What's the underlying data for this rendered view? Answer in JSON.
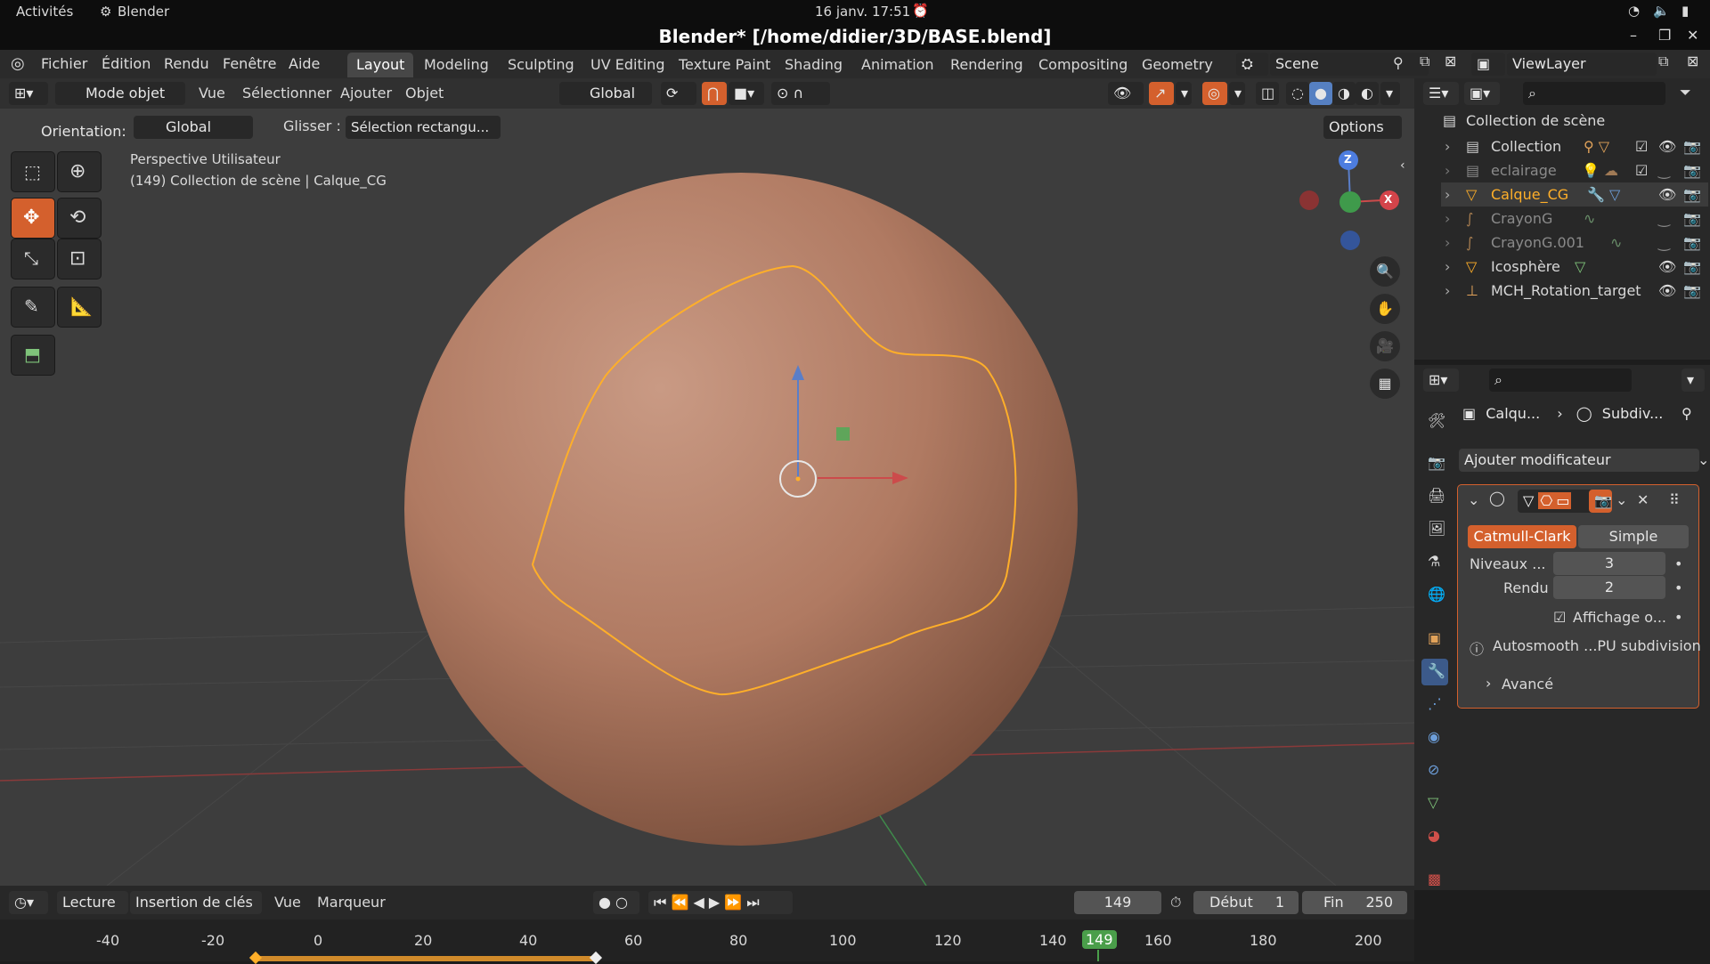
{
  "gnome": {
    "activities": "Activités",
    "app": "Blender",
    "clock": "16 janv.  17:51"
  },
  "window": {
    "title": "Blender* [/home/didier/3D/BASE.blend]"
  },
  "menus": [
    "Fichier",
    "Édition",
    "Rendu",
    "Fenêtre",
    "Aide"
  ],
  "workspaces": [
    "Layout",
    "Modeling",
    "Sculpting",
    "UV Editing",
    "Texture Paint",
    "Shading",
    "Animation",
    "Rendering",
    "Compositing",
    "Geometry Nc"
  ],
  "scene": {
    "name": "Scene",
    "view_layer": "ViewLayer"
  },
  "viewport_header": {
    "mode": "Mode objet",
    "view": "Vue",
    "select": "Sélectionner",
    "add": "Ajouter",
    "object": "Objet",
    "transform": "Global"
  },
  "tool_header": {
    "orientation_label": "Orientation:",
    "orientation_value": "Global",
    "drag_label": "Glisser :",
    "drag_value": "Sélection rectangu...",
    "options": "Options"
  },
  "viewport": {
    "perspective": "Perspective Utilisateur",
    "collection_info": "(149) Collection de scène | Calque_CG",
    "axes": {
      "x": "X",
      "y": "Y",
      "z": "Z"
    }
  },
  "outliner": {
    "root": "Collection de scène",
    "items": [
      {
        "name": "Collection",
        "color": "#d8d8d8"
      },
      {
        "name": "eclairage",
        "color": "#8a8a8a"
      },
      {
        "name": "Calque_CG",
        "color": "#ffaf29"
      },
      {
        "name": "CrayonG",
        "color": "#8a8a8a"
      },
      {
        "name": "CrayonG.001",
        "color": "#8a8a8a"
      },
      {
        "name": "Icosphère",
        "color": "#d8d8d8"
      },
      {
        "name": "MCH_Rotation_target",
        "color": "#d8d8d8"
      }
    ]
  },
  "properties": {
    "breadcrumb_object": "Calqu...",
    "breadcrumb_modifier": "Subdiv...",
    "add_modifier": "Ajouter modificateur",
    "catmull": "Catmull-Clark",
    "simple": "Simple",
    "levels_label": "Niveaux ...",
    "levels_value": "3",
    "render_label": "Rendu",
    "render_value": "2",
    "display_label": "Affichage o...",
    "autosmooth": "Autosmooth ...PU subdivision",
    "advanced": "Avancé"
  },
  "timeline": {
    "playback": "Lecture",
    "keying": "Insertion de clés",
    "view": "Vue",
    "marker": "Marqueur",
    "current_frame": "149",
    "start_label": "Début",
    "start_value": "1",
    "end_label": "Fin",
    "end_value": "250",
    "ruler": [
      "-40",
      "-20",
      "0",
      "20",
      "40",
      "60",
      "80",
      "100",
      "120",
      "140",
      "149",
      "160",
      "180",
      "200"
    ]
  },
  "colors": {
    "accent": "#d4602d",
    "selection": "#ffaf29",
    "sphere": "#b07a62"
  }
}
